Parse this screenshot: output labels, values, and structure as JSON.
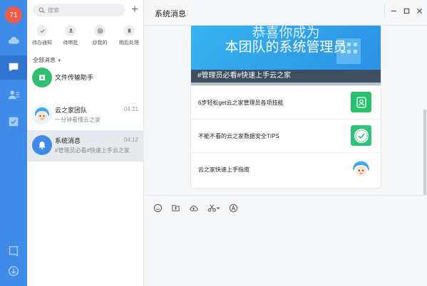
{
  "rail": {
    "avatar_text": "71",
    "accent": "#3f8be8",
    "icons": [
      "cloud-icon",
      "chat-icon",
      "contacts-icon",
      "tasks-icon",
      "notes-icon",
      "download-icon"
    ]
  },
  "list": {
    "search_placeholder": "搜索",
    "add_label": "+",
    "shortcuts": [
      {
        "label": "待办通知",
        "icon": "check-icon"
      },
      {
        "label": "待审批",
        "icon": "stamp-icon"
      },
      {
        "label": "@我的",
        "icon": "at-icon"
      },
      {
        "label": "稍后处理",
        "icon": "bookmark-icon"
      }
    ],
    "section_label": "全部消息",
    "conversations": [
      {
        "title": "文件传输助手",
        "subtitle": "",
        "time": "",
        "avatar": "transfer-icon"
      },
      {
        "title": "云之家团队",
        "subtitle": "一分钟看懂云之家",
        "time": "04:21",
        "avatar": "mascot-avatar"
      },
      {
        "title": "系统消息",
        "subtitle": "#管理员必看#快速上手云之家",
        "time": "04:12",
        "avatar": "bell-icon",
        "selected": true
      }
    ]
  },
  "chat": {
    "title": "系统消息",
    "card": {
      "banner_line1": "恭喜你成为",
      "banner_line2": "本团队的系统管理员",
      "banner_tag": "#管理员必看#快速上手云之家",
      "articles": [
        {
          "title": "6步轻松get云之家管理员各项技能",
          "thumb": "user-card-icon"
        },
        {
          "title": "不能不看的云之家数据安全TIPS",
          "thumb": "security-badge-icon"
        },
        {
          "title": "云之家快速上手指南",
          "thumb": "mascot-avatar"
        }
      ]
    },
    "toolbar": [
      "emoji-icon",
      "file-icon",
      "cloud-upload-icon",
      "scissors-icon",
      "format-icon"
    ]
  }
}
